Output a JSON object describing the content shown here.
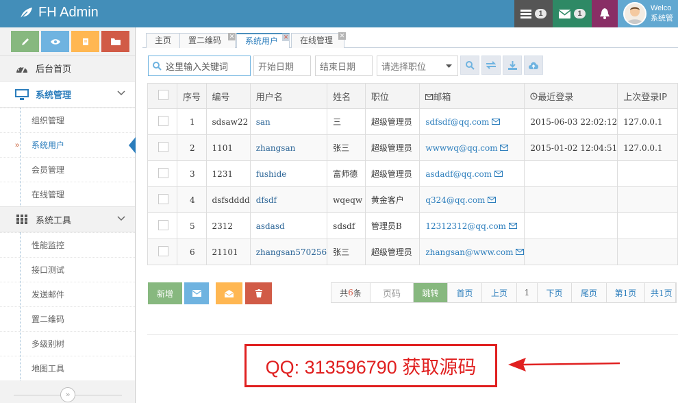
{
  "app": {
    "brand": "FH Admin",
    "badges": {
      "tasks": "1",
      "mail": "1"
    },
    "user_greeting": "Welco",
    "user_role": "系统管"
  },
  "sidebar": {
    "home": "后台首页",
    "system_mgmt": "系统管理",
    "system_items": [
      "组织管理",
      "系统用户",
      "会员管理",
      "在线管理"
    ],
    "tools": "系统工具",
    "tool_items": [
      "性能监控",
      "接口测试",
      "发送邮件",
      "置二维码",
      "多级别树",
      "地图工具"
    ]
  },
  "tabs": [
    "主页",
    "置二维码",
    "系统用户",
    "在线管理"
  ],
  "toolbar": {
    "search_placeholder": "这里输入关键词",
    "start_date": "开始日期",
    "end_date": "结束日期",
    "role_select": "请选择职位"
  },
  "table": {
    "headers": [
      "序号",
      "编号",
      "用户名",
      "姓名",
      "职位",
      "邮箱",
      "最近登录",
      "上次登录IP"
    ],
    "rows": [
      [
        "1",
        "sdsaw22",
        "san",
        "三",
        "超级管理员",
        "sdfsdf@qq.com",
        "2015-06-03 22:02:12",
        "127.0.0.1"
      ],
      [
        "2",
        "1101",
        "zhangsan",
        "张三",
        "超级管理员",
        "wwwwq@qq.com",
        "2015-01-02 12:04:51",
        "127.0.0.1"
      ],
      [
        "3",
        "1231",
        "fushide",
        "富师德",
        "超级管理员",
        "asdadf@qq.com",
        "",
        ""
      ],
      [
        "4",
        "dsfsdddd",
        "dfsdf",
        "wqeqw",
        "黄金客户",
        "q324@qq.com",
        "",
        ""
      ],
      [
        "5",
        "2312",
        "asdasd",
        "sdsdf",
        "管理员B",
        "12312312@qq.com",
        "",
        ""
      ],
      [
        "6",
        "21101",
        "zhangsan570256",
        "张三",
        "超级管理员",
        "zhangsan@www.com",
        "",
        ""
      ]
    ]
  },
  "actions": {
    "add": "新增"
  },
  "pager": {
    "total_prefix": "共",
    "total_count": "6",
    "total_suffix": "条",
    "page_input": "页码",
    "jump": "跳转",
    "first": "首页",
    "prev": "上页",
    "current": "1",
    "next": "下页",
    "last": "尾页",
    "page_no": "第1页",
    "page_total": "共1页"
  },
  "promo": "QQ: 313596790 获取源码",
  "colors": {
    "navbar": "#438eb9",
    "sidebar_accent": "#2b7dbc",
    "btn_success": "#87b87f",
    "btn_info": "#6fb3e0",
    "btn_warning": "#ffb752",
    "btn_danger": "#d15b47",
    "promo": "#e02020"
  }
}
